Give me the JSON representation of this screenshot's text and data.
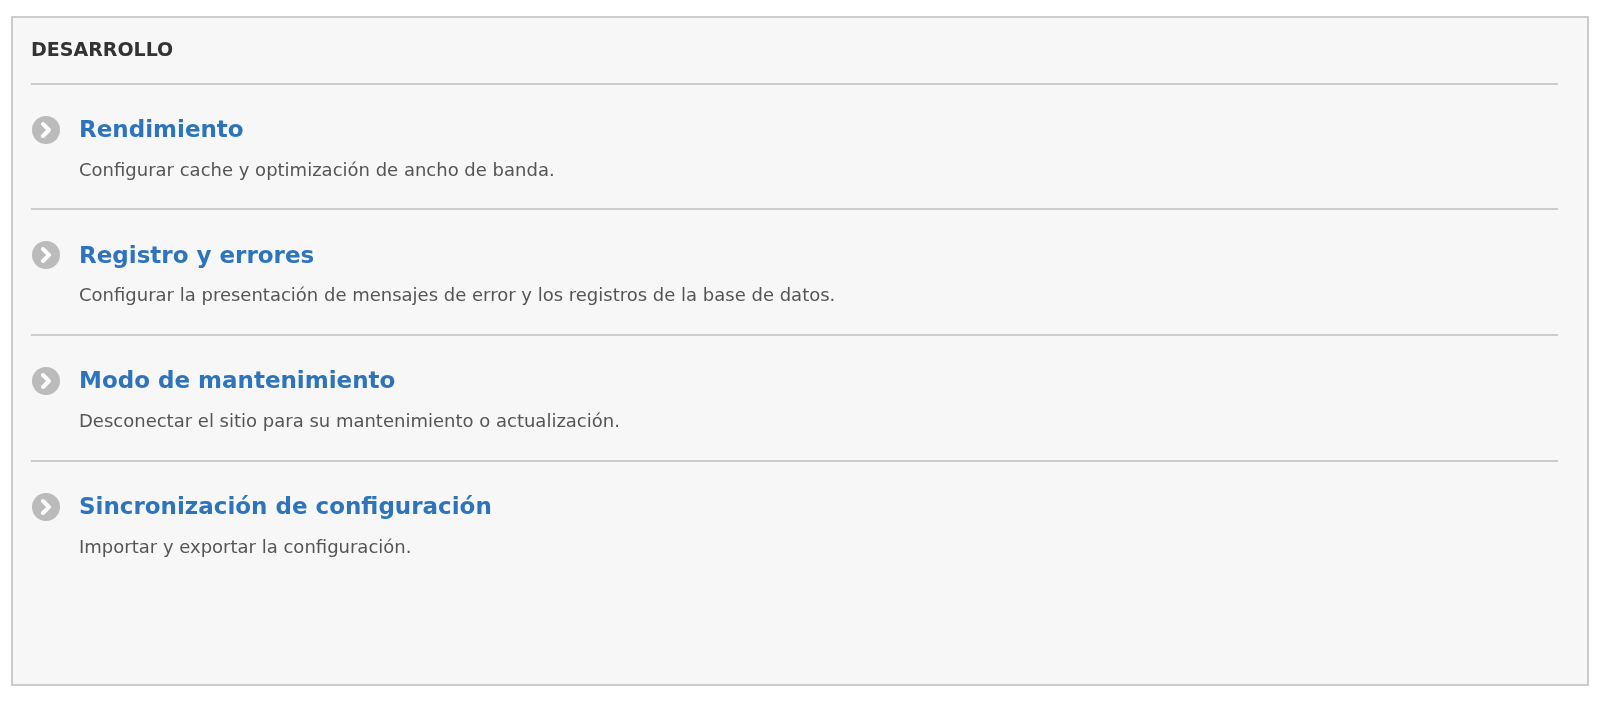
{
  "panel": {
    "title": "DESARROLLO",
    "items": [
      {
        "title": "Rendimiento",
        "description": "Configurar cache y optimización de ancho de banda."
      },
      {
        "title": "Registro y errores",
        "description": "Configurar la presentación de mensajes de error y los registros de la base de datos."
      },
      {
        "title": "Modo de mantenimiento",
        "description": "Desconectar el sitio para su mantenimiento o actualización."
      },
      {
        "title": "Sincronización de configuración",
        "description": "Importar y exportar la configuración."
      }
    ]
  }
}
